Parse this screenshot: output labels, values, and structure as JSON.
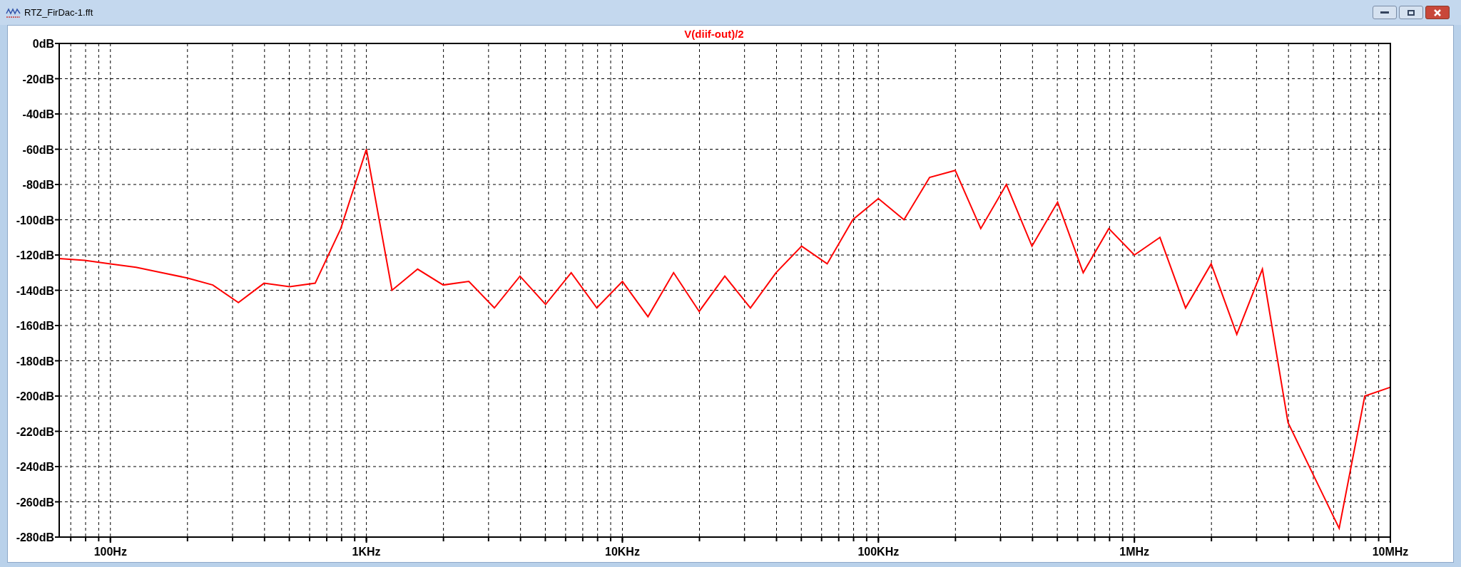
{
  "window": {
    "title": "RTZ_FirDac-1.fft"
  },
  "plot": {
    "chart_data": {
      "type": "line",
      "title": "V(diif-out)/2",
      "grid": true,
      "ylim": [
        -280,
        0
      ],
      "yticks": [
        {
          "value": 0,
          "label": "0dB"
        },
        {
          "value": -20,
          "label": "-20dB"
        },
        {
          "value": -40,
          "label": "-40dB"
        },
        {
          "value": -60,
          "label": "-60dB"
        },
        {
          "value": -80,
          "label": "-80dB"
        },
        {
          "value": -100,
          "label": "-100dB"
        },
        {
          "value": -120,
          "label": "-120dB"
        },
        {
          "value": -140,
          "label": "-140dB"
        },
        {
          "value": -160,
          "label": "-160dB"
        },
        {
          "value": -180,
          "label": "-180dB"
        },
        {
          "value": -200,
          "label": "-200dB"
        },
        {
          "value": -220,
          "label": "-220dB"
        },
        {
          "value": -240,
          "label": "-240dB"
        },
        {
          "value": -260,
          "label": "-260dB"
        },
        {
          "value": -280,
          "label": "-280dB"
        }
      ],
      "categories": [
        null,
        null,
        "100Hz",
        null,
        null,
        null,
        null,
        null,
        null,
        null,
        null,
        null,
        "1KHz",
        null,
        null,
        null,
        null,
        null,
        null,
        null,
        null,
        null,
        "10KHz",
        null,
        null,
        null,
        null,
        null,
        null,
        null,
        null,
        null,
        "100KHz",
        null,
        null,
        null,
        null,
        null,
        null,
        null,
        null,
        null,
        "1MHz",
        null,
        null,
        null,
        null,
        null,
        null,
        null,
        null,
        null,
        "10MHz"
      ],
      "series": [
        {
          "color": "#ff0000",
          "values": [
            -122,
            -123,
            -125,
            -127,
            -130,
            -133,
            -137,
            -147,
            -136,
            -138,
            -136,
            -105,
            -60,
            -140,
            -128,
            -137,
            -135,
            -150,
            -132,
            -148,
            -130,
            -150,
            -135,
            -155,
            -130,
            -152,
            -132,
            -150,
            -130,
            -115,
            -125,
            -100,
            -88,
            -100,
            -76,
            -72,
            -105,
            -80,
            -115,
            -90,
            -130,
            -105,
            -120,
            -110,
            -150,
            -125,
            -165,
            -128,
            -215,
            -245,
            -275,
            -200,
            -195
          ]
        }
      ]
    }
  }
}
